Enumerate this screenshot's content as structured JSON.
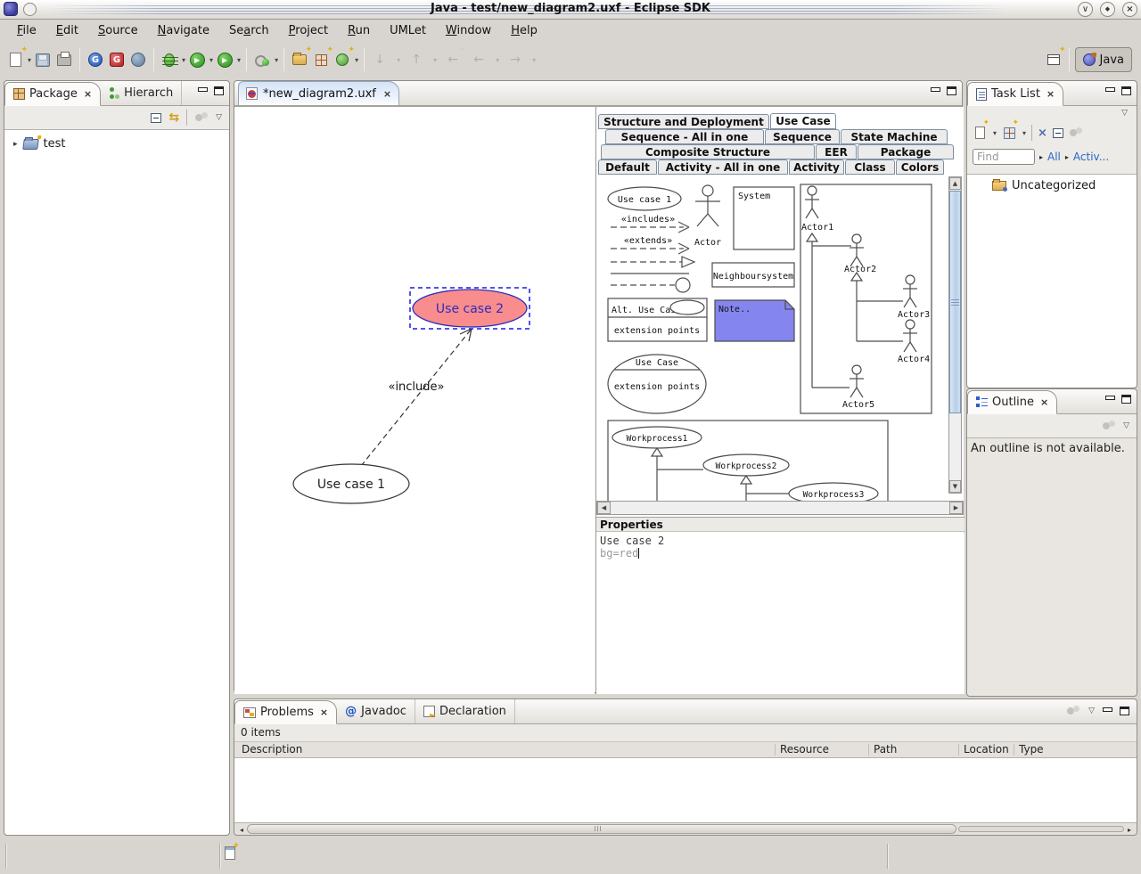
{
  "titlebar": {
    "title": "Java - test/new_diagram2.uxf - Eclipse SDK"
  },
  "menus": [
    {
      "pre": "",
      "u": "F",
      "post": "ile"
    },
    {
      "pre": "",
      "u": "E",
      "post": "dit"
    },
    {
      "pre": "",
      "u": "S",
      "post": "ource"
    },
    {
      "pre": "",
      "u": "N",
      "post": "avigate"
    },
    {
      "pre": "Se",
      "u": "a",
      "post": "rch"
    },
    {
      "pre": "",
      "u": "P",
      "post": "roject"
    },
    {
      "pre": "",
      "u": "R",
      "post": "un"
    },
    {
      "pre": "UMLet",
      "u": "",
      "post": ""
    },
    {
      "pre": "",
      "u": "W",
      "post": "indow"
    },
    {
      "pre": "",
      "u": "H",
      "post": "elp"
    }
  ],
  "perspective": {
    "java": "Java"
  },
  "package_panel": {
    "tab_package": "Package",
    "tab_hierarchy": "Hierarch",
    "tree_item": "test"
  },
  "editor": {
    "tab": "*new_diagram2.uxf"
  },
  "palette": {
    "tabs": {
      "r1c1": "Structure and Deployment",
      "r1c2": "Use Case",
      "r2c1": "Sequence - All in one",
      "r2c2": "Sequence",
      "r2c3": "State Machine",
      "r3c1": "Composite Structure",
      "r3c2": "EER",
      "r3c3": "Package",
      "r4c1": "Default",
      "r4c2": "Activity - All in one",
      "r4c3": "Activity",
      "r4c4": "Class",
      "r4c5": "Colors"
    },
    "active_tab": "Use Case",
    "items": {
      "use_case": "Use case 1",
      "includes": "«includes»",
      "extends": "«extends»",
      "actor": "Actor",
      "system": "System",
      "neighbour": "Neighboursystem",
      "alt_title": "Alt. Use Case",
      "alt_ext": "extension points",
      "note": "Note..",
      "big_title": "Use Case",
      "big_ext": "extension points",
      "actor1": "Actor1",
      "actor2": "Actor2",
      "actor3": "Actor3",
      "actor4": "Actor4",
      "actor5": "Actor5",
      "wp1": "Workprocess1",
      "wp2": "Workprocess2",
      "wp3": "Workprocess3"
    },
    "colors": {
      "note_fill": "#8585f0"
    }
  },
  "canvas": {
    "use_case_2": "Use case 2",
    "use_case_1": "Use case 1",
    "edge_label": "«include»",
    "colors": {
      "selected_fill": "#f98c8c",
      "selected_stroke": "#2d2dc0",
      "selection_box": "#1a1ae6"
    }
  },
  "properties": {
    "title": "Properties",
    "line1": "Use case 2",
    "line2": "bg=red"
  },
  "task_list": {
    "title": "Task List",
    "find": "Find",
    "all": "All",
    "activate": "Activ...",
    "uncategorized": "Uncategorized"
  },
  "outline": {
    "title": "Outline",
    "message": "An outline is not available."
  },
  "problems": {
    "tab_problems": "Problems",
    "tab_javadoc": "Javadoc",
    "tab_declaration": "Declaration",
    "count": "0 items",
    "col_description": "Description",
    "col_resource": "Resource",
    "col_path": "Path",
    "col_location": "Location",
    "col_type": "Type"
  },
  "icons": {
    "chevron_down": "▾",
    "view_menu": "▽",
    "arrow_right_small": "▸",
    "twisty": "▸",
    "scroll_up": "▲",
    "scroll_down": "▼",
    "scroll_left": "◀",
    "scroll_right": "▶",
    "h_left": "◂",
    "h_right": "▸",
    "close": "×",
    "at": "@",
    "link_arrows": "⇆",
    "play": "▶",
    "win_shade": "∨",
    "win_dot": "◆",
    "nav_down": "↓",
    "nav_up": "↑",
    "nav_back": "←",
    "nav_forward": "→",
    "nav_last": "←",
    "sparkle": "✦",
    "delete_x": "×",
    "g_letter": "G"
  }
}
